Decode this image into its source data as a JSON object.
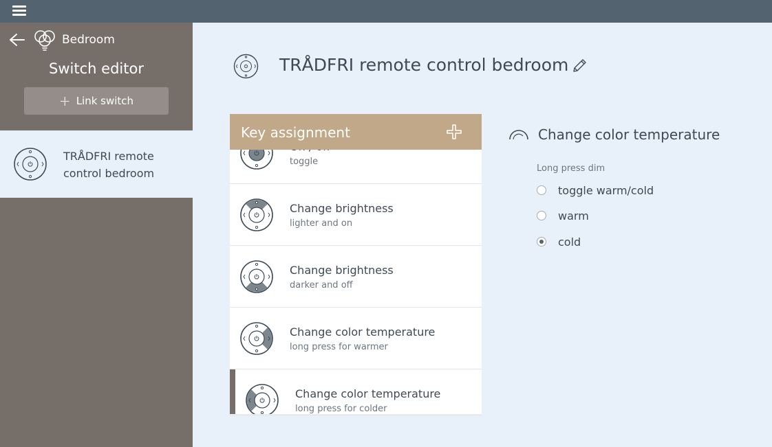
{
  "topbar": {
    "menu_icon": "hamburger-menu-icon"
  },
  "sidebar": {
    "room_name": "Bedroom",
    "title": "Switch editor",
    "link_button_label": "Link switch",
    "selected_switch_label": "TRÅDFRI remote control bedroom"
  },
  "main": {
    "title": "TRÅDFRI remote control bedroom",
    "key_card": {
      "title": "Key assignment",
      "rows": [
        {
          "name": "On / off",
          "sub": "toggle",
          "active_button": "center"
        },
        {
          "name": "Change brightness",
          "sub": "lighter and on",
          "active_button": "top"
        },
        {
          "name": "Change brightness",
          "sub": "darker and off",
          "active_button": "bottom"
        },
        {
          "name": "Change color temperature",
          "sub": "long press for warmer",
          "active_button": "right"
        },
        {
          "name": "Change color temperature",
          "sub": "long press for colder",
          "active_button": "left"
        }
      ]
    },
    "detail": {
      "title": "Change color temperature",
      "group_label": "Long press dim",
      "options": [
        {
          "label": "toggle warm/cold",
          "checked": false
        },
        {
          "label": "warm",
          "checked": false
        },
        {
          "label": "cold",
          "checked": true
        }
      ]
    }
  },
  "colors": {
    "topbar": "#546370",
    "sidebar": "#766e69",
    "background": "#e8f0f9",
    "card_header": "#c0a888",
    "text": "#3d4a55"
  }
}
